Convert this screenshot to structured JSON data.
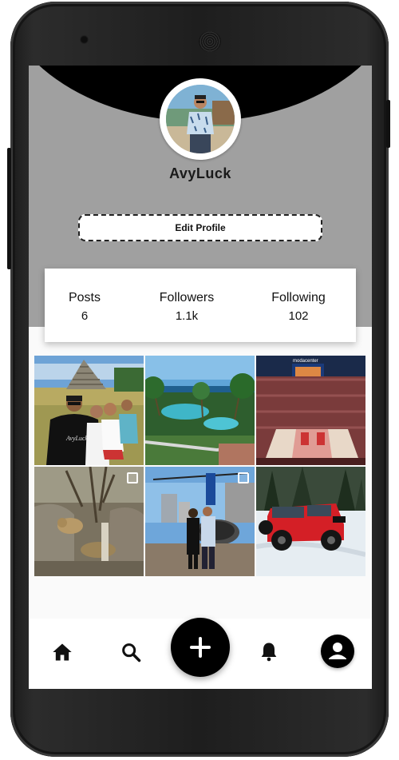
{
  "profile": {
    "username": "AvyLuck",
    "edit_button_label": "Edit Profile"
  },
  "stats": {
    "posts": {
      "label": "Posts",
      "value": "6"
    },
    "followers": {
      "label": "Followers",
      "value": "1.1k"
    },
    "following": {
      "label": "Following",
      "value": "102"
    }
  },
  "photos": [
    {
      "name": "photo-pyramid-selfie",
      "multiple": false
    },
    {
      "name": "photo-resort-pool",
      "multiple": false
    },
    {
      "name": "photo-basketball-arena",
      "multiple": false
    },
    {
      "name": "photo-lions-zoo",
      "multiple": true
    },
    {
      "name": "photo-helicopter-couple",
      "multiple": true
    },
    {
      "name": "photo-red-jeep-snow",
      "multiple": false
    }
  ],
  "arena_sign": "modacenter",
  "tshirt_text": "AvyLuck",
  "bottom_nav": {
    "items": [
      "home-icon",
      "search-icon",
      "add-icon",
      "bell-icon",
      "profile-icon"
    ]
  },
  "colors": {
    "header_gray": "#a0a0a0",
    "accent_black": "#000000"
  }
}
